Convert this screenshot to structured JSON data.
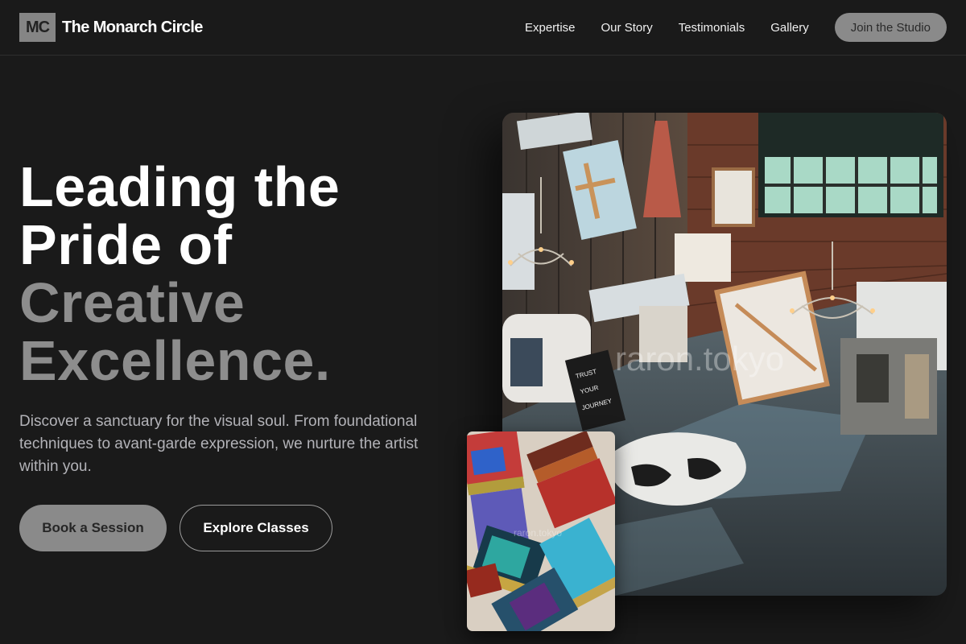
{
  "header": {
    "logo_mark": "MC",
    "brand_name": "The Monarch Circle",
    "nav": [
      "Expertise",
      "Our Story",
      "Testimonials",
      "Gallery"
    ],
    "cta_label": "Join the Studio"
  },
  "hero": {
    "headline_lines": [
      "Leading the",
      "Pride of",
      "Creative",
      "Excellence."
    ],
    "subtext": "Discover a sanctuary for the visual soul. From foundational techniques to avant-garde expression, we nurture the artist within you.",
    "primary_button": "Book a Session",
    "secondary_button": "Explore Classes"
  },
  "images": {
    "studio_watermark": "raron.tokyo",
    "brush_watermark": "raron.tokyo"
  },
  "colors": {
    "background": "#1a1a1a",
    "accent_grey": "#8a8a8a",
    "headline_grey": "#8d8d8d"
  }
}
